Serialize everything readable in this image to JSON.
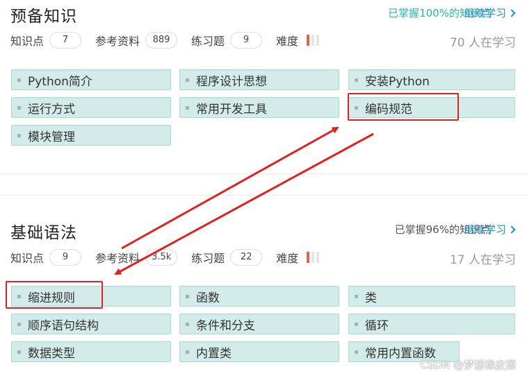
{
  "sections": [
    {
      "title": "预备知识",
      "progress_prefix": "已掌握",
      "progress_value": "100%",
      "progress_suffix": "的知识点",
      "continue_label": "继续学习",
      "stats": {
        "points_label": "知识点",
        "points_value": "7",
        "refs_label": "参考资料",
        "refs_value": "889",
        "exercises_label": "练习题",
        "exercises_value": "9",
        "difficulty_label": "难度"
      },
      "difficulty_level": 1,
      "learners": "70 人在学习",
      "tags": [
        "Python简介",
        "程序设计思想",
        "安装Python",
        "运行方式",
        "常用开发工具",
        "编码规范",
        "模块管理"
      ]
    },
    {
      "title": "基础语法",
      "progress_prefix": "已掌握",
      "progress_value": "96%",
      "progress_suffix": "的知识点",
      "continue_label": "继续学习",
      "stats": {
        "points_label": "知识点",
        "points_value": "9",
        "refs_label": "参考资料",
        "refs_value": "3.5k",
        "exercises_label": "练习题",
        "exercises_value": "22",
        "difficulty_label": "难度"
      },
      "difficulty_level": 1,
      "learners": "17 人在学习",
      "tags": [
        "缩进规则",
        "函数",
        "类",
        "顺序语句结构",
        "条件和分支",
        "循环",
        "数据类型",
        "内置类",
        "常用内置函数"
      ]
    }
  ],
  "colors": {
    "accent": "#1a8fc9",
    "progress_full": "#2ab3a6",
    "progress_partial": "#555555",
    "tag_bg": "#d3ecea",
    "highlight": "#e02020"
  },
  "watermark": "CSDN @梦想橡皮擦"
}
